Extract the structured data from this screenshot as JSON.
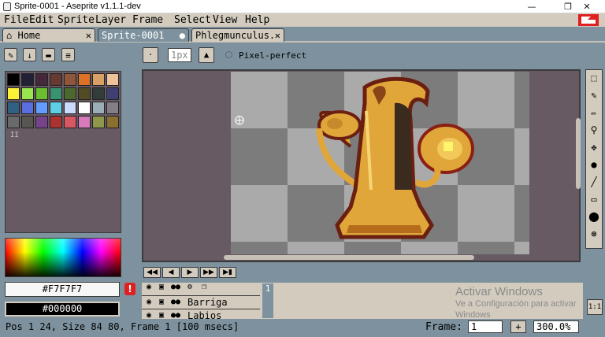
{
  "window": {
    "title": "Sprite-0001 - Aseprite v1.1.1-dev",
    "minimize": "—",
    "maximize": "❐",
    "close": "✕"
  },
  "menu": [
    "File",
    "Edit",
    "Sprite",
    "Layer",
    "Frame",
    "Select",
    "View",
    "Help"
  ],
  "tabs": [
    {
      "label": "Home",
      "close": "✕"
    },
    {
      "label": "Sprite-0001",
      "close": "●"
    },
    {
      "label": "Phlegmunculus.",
      "close": "✕"
    }
  ],
  "context": {
    "brush_size": "1px",
    "pixel_perfect_label": "Pixel-perfect"
  },
  "palette": {
    "colors": [
      "#000000",
      "#222034",
      "#45283c",
      "#663931",
      "#8f563b",
      "#df7126",
      "#d9a066",
      "#eec39a",
      "#fbf236",
      "#99e550",
      "#6abe30",
      "#37946e",
      "#4b692f",
      "#524b24",
      "#323c39",
      "#3f3f74",
      "#306082",
      "#5b6ee1",
      "#639bff",
      "#5fcde4",
      "#cbdbfc",
      "#ffffff",
      "#9badb7",
      "#847e87",
      "#696a6a",
      "#595652",
      "#76428a",
      "#ac3232",
      "#d95763",
      "#d77bba",
      "#8f974a",
      "#8a6f30"
    ],
    "marker": "II"
  },
  "colors": {
    "fg_hex": "#F7F7F7",
    "bg_hex": "#000000",
    "warning": "!"
  },
  "timeline": {
    "layers": [
      {
        "name": "Barriga",
        "frame_cell": "1"
      },
      {
        "name": "Labios",
        "frame_cell": ""
      }
    ],
    "eye_icon": "👁",
    "lock_icon": "🔒",
    "onion_icon": "●●"
  },
  "watermark": {
    "line1": "Activar Windows",
    "line2": "Ve a Configuración para activar",
    "line3": "Windows"
  },
  "status": {
    "text": "Pos 1 24, Size 84 80, Frame 1 [100 msecs]",
    "frame_label": "Frame:",
    "frame_value": "1",
    "add_frame": "+",
    "zoom": "300.0%",
    "ratio_button": "1:1"
  }
}
